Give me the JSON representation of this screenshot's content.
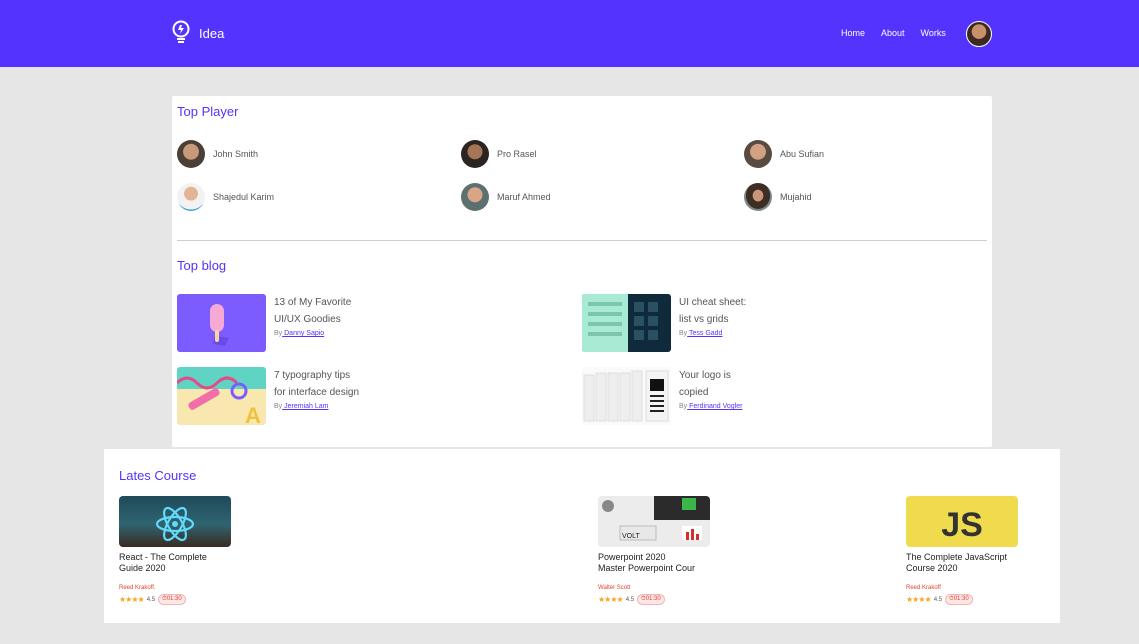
{
  "header": {
    "brand": "Idea",
    "nav": [
      "Home",
      "About",
      "Works"
    ]
  },
  "top_player": {
    "title": "Top Player",
    "players": [
      {
        "name": "John Smith"
      },
      {
        "name": "Pro Rasel"
      },
      {
        "name": "Abu Sufian"
      },
      {
        "name": "Shajedul Karim"
      },
      {
        "name": "Maruf Ahmed"
      },
      {
        "name": "Mujahid"
      }
    ]
  },
  "top_blog": {
    "title": "Top blog",
    "posts": [
      {
        "line1": "13 of My Favorite",
        "line2": "UI/UX Goodies",
        "by": "By",
        "author": " Danny Sapio"
      },
      {
        "line1": "UI cheat sheet:",
        "line2": "list vs grids",
        "by": "By",
        "author": " Tess Gadd"
      },
      {
        "line1": "7 typography tips",
        "line2": "for interface design",
        "by": "By",
        "author": " Jeremiah Lam"
      },
      {
        "line1": "Your logo is",
        "line2": "copied",
        "by": "By",
        "author": " Ferdinand Vogler"
      }
    ]
  },
  "latest_course": {
    "title": "Lates Course",
    "courses": [
      {
        "line1": "React - The Complete",
        "line2": "Guide 2020",
        "author": "Reed Krakoff.",
        "stars": "★★★★",
        "rating": "4.5",
        "duration": "⏱01:30"
      },
      {
        "line1": "Powerpoint 2020",
        "line2": "Master Powerpoint Cour",
        "author": "Walter Scott",
        "stars": "★★★★",
        "rating": "4.5",
        "duration": "⏱01:30"
      },
      {
        "line1": "The Complete JavaScript",
        "line2": "Course 2020",
        "author": "Reed Krakoff",
        "stars": "★★★★",
        "rating": "4.5",
        "duration": "⏱01:30"
      }
    ],
    "thumb_text": {
      "ppt": "VOLT",
      "js": "JS"
    }
  },
  "colors": {
    "accent": "#5433ff",
    "background": "#e6e6e6",
    "author": "#e2442f",
    "star": "#f5a623"
  }
}
